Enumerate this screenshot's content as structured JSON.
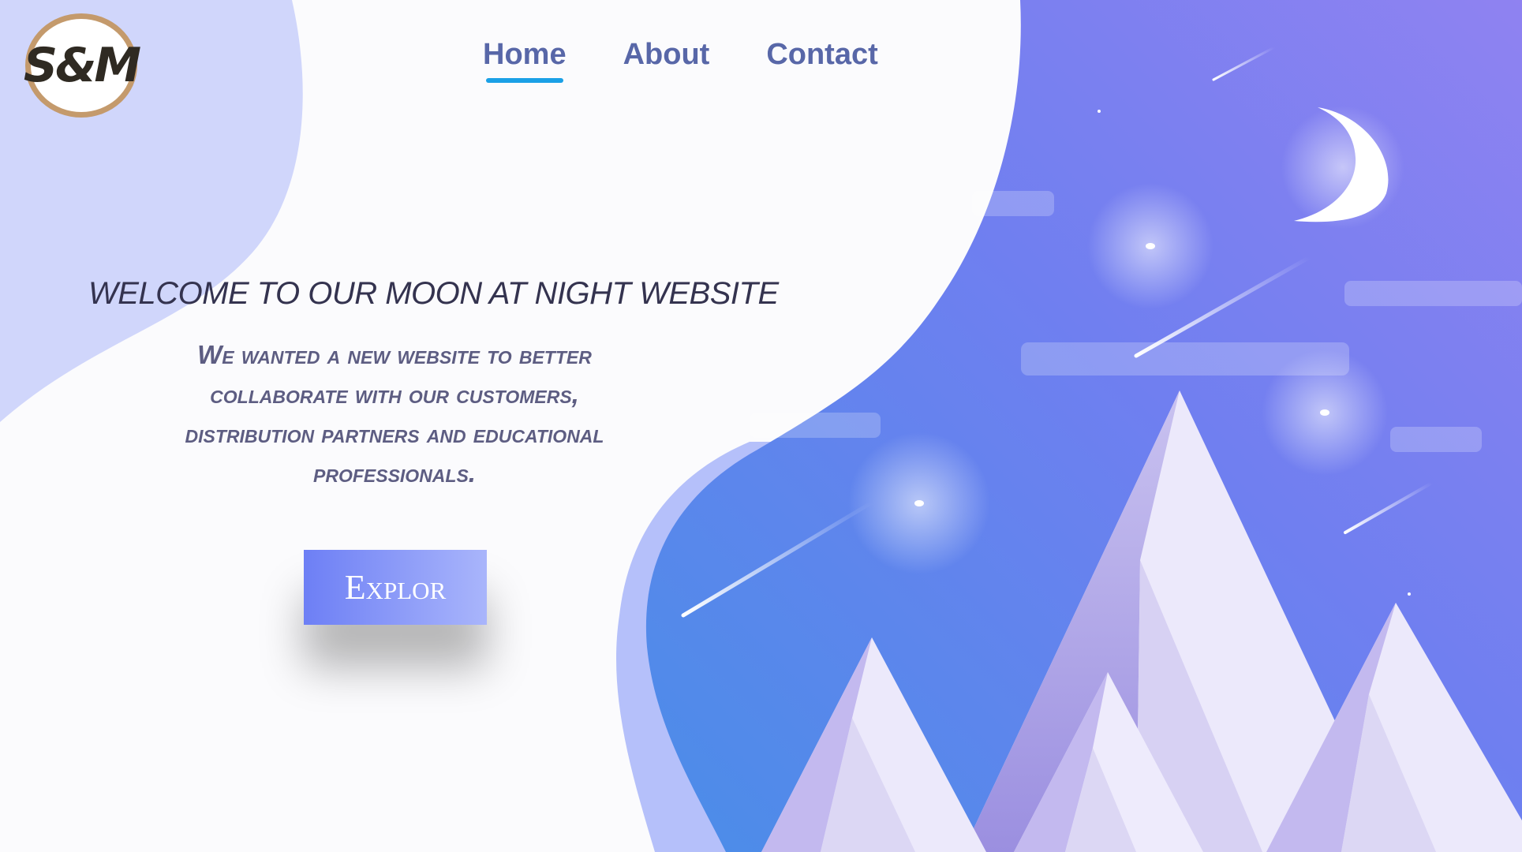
{
  "logo": {
    "text": "S&M"
  },
  "nav": {
    "items": [
      {
        "label": "Home",
        "active": true
      },
      {
        "label": "About",
        "active": false
      },
      {
        "label": "Contact",
        "active": false
      }
    ]
  },
  "hero": {
    "headline": "WELCOME TO OUR MOON AT NIGHT WEBSITE",
    "description": "We wanted a new website to better collaborate with our customers, distribution partners and educational professionals.",
    "cta_label": "Explor"
  },
  "colors": {
    "nav_text": "#5867a8",
    "nav_active_underline": "#1aa0e6",
    "logo_border": "#c49a6c",
    "night_sky_blue": "#4a8de8",
    "night_sky_violet": "#8a7ff0",
    "button_gradient_start": "#6d7ff5",
    "button_gradient_end": "#a9b5fb"
  },
  "icons": {
    "illustration": "moon-night-mountains-illustration"
  }
}
